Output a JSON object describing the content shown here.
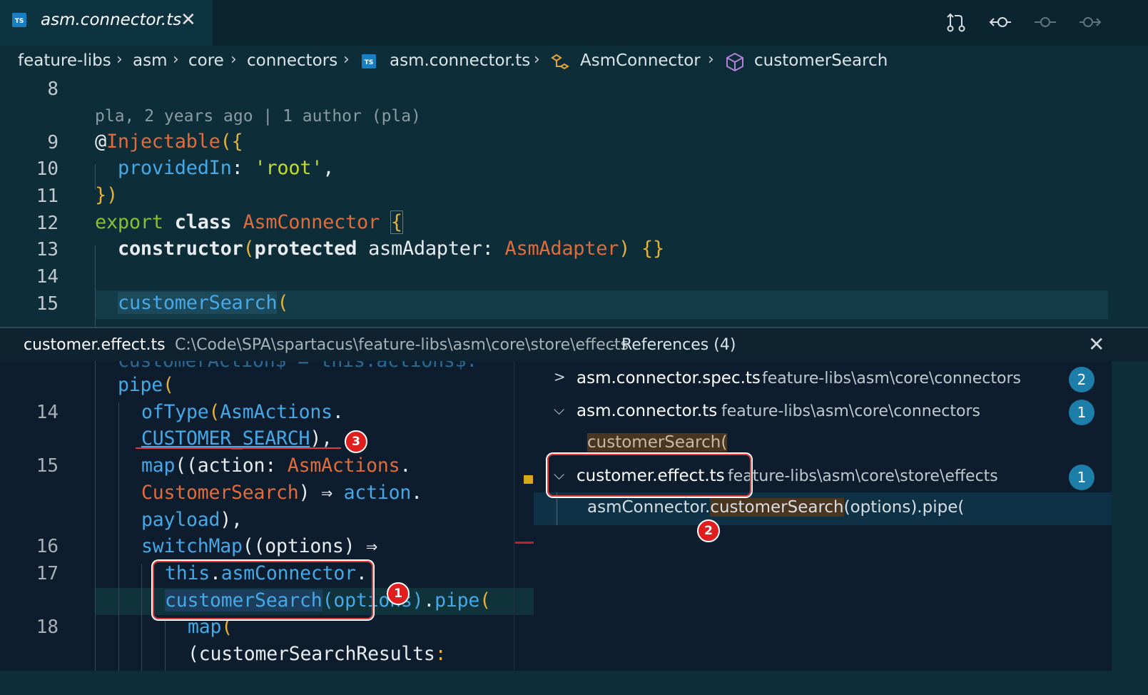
{
  "tab": {
    "title": "asm.connector.ts",
    "badge": "TS"
  },
  "breadcrumb": {
    "items": [
      "feature-libs",
      "asm",
      "core",
      "connectors",
      "asm.connector.ts",
      "AsmConnector",
      "customerSearch"
    ]
  },
  "editor": {
    "blame": "pla, 2 years ago | 1 author (pla)",
    "line_numbers": [
      "8",
      "9",
      "10",
      "11",
      "12",
      "13",
      "14",
      "15"
    ],
    "lines": {
      "l9_at": "@",
      "l9_name": "Injectable",
      "l9_brace": "({",
      "l10_key": "providedIn",
      "l10_colon": ": ",
      "l10_value": "'root'",
      "l10_comma": ",",
      "l11": "})",
      "l12_export": "export",
      "l12_class": "class",
      "l12_name": "AsmConnector",
      "l12_brace": "{",
      "l13_ctor": "constructor",
      "l13_paren": "(",
      "l13_protected": "protected",
      "l13_param": "asmAdapter",
      "l13_colon": ": ",
      "l13_type": "AsmAdapter",
      "l13_end": ") {}",
      "l15_name": "customerSearch",
      "l15_paren": "("
    }
  },
  "peek": {
    "file": "customer.effect.ts",
    "path": "C:\\Code\\SPA\\spartacus\\feature-libs\\asm\\core\\store\\effects",
    "separator": "-",
    "title": "References (4)",
    "line_numbers": [
      "14",
      "15",
      "16",
      "17",
      "18"
    ],
    "code": {
      "top_partial": "customerAction$ = this.actions$.",
      "pipe": "pipe",
      "pipe_paren": "(",
      "oftype": "ofType",
      "oftype_paren": "(",
      "asmactions": "AsmActions",
      "dot": ".",
      "customer_search_const": "CUSTOMER_SEARCH",
      "close_comma": "),",
      "map": "map",
      "map_open": "((",
      "action": "action",
      "colon": ": ",
      "asmactions2": "AsmActions",
      "dot2": ".",
      "customersearch_type": "CustomerSearch",
      "arrow": ") ⇒ ",
      "action2": "action",
      "dot3": ".",
      "payload": "payload",
      "payload_end": "),",
      "switchmap": "switchMap",
      "switchmap_rest": "((options) ⇒",
      "this": "this",
      "dot4": ".",
      "asmconnector": "asmConnector",
      "dot5": ".",
      "customersearch_call": "customerSearch",
      "options": "(options)",
      "dot6": ".",
      "pipe2": "pipe",
      "pipe2_paren": "(",
      "map2": "map",
      "map2_paren": "(",
      "results": "(customerSearchResults",
      "results_colon": ":"
    }
  },
  "references": {
    "groups": [
      {
        "file": "asm.connector.spec.ts",
        "path": "feature-libs\\asm\\core\\connectors",
        "count": "2",
        "expanded": false
      },
      {
        "file": "asm.connector.ts",
        "path": "feature-libs\\asm\\core\\connectors",
        "count": "1",
        "expanded": true,
        "match": "customerSearch("
      },
      {
        "file": "customer.effect.ts",
        "path": "feature-libs\\asm\\core\\store\\effects",
        "count": "1",
        "expanded": true,
        "match_prefix": "asmConnector.",
        "match_highlight": "customerSearch",
        "match_suffix": "(options).pipe("
      }
    ]
  },
  "annotations": {
    "markers": [
      "1",
      "2",
      "3"
    ],
    "color": "#e23a3a"
  },
  "colors": {
    "editor_bg": "#0d2d38",
    "peek_bg": "#0d1d2d",
    "accent": "#1e7eaa"
  }
}
